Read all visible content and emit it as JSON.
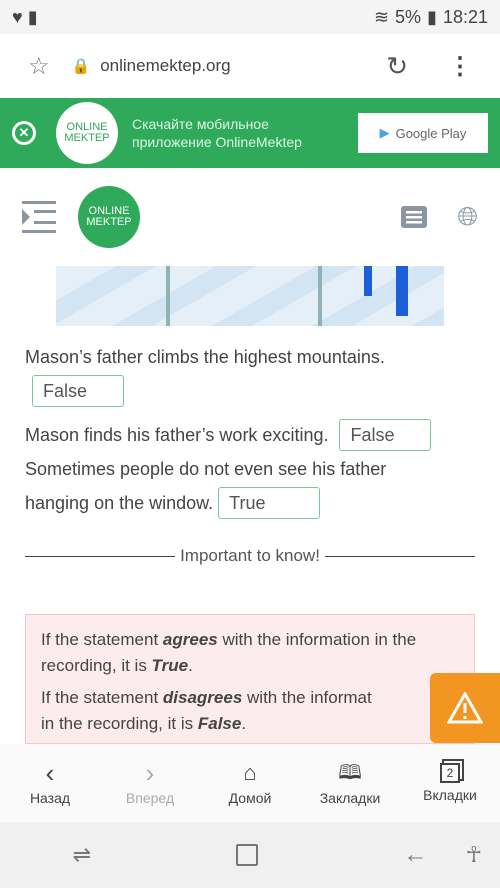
{
  "status": {
    "battery": "5%",
    "time": "18:21"
  },
  "browser": {
    "url": "onlinemektep.org"
  },
  "banner": {
    "logo": "ONLINE MEKTEP",
    "line1": "Скачайте мобильное",
    "line2": "приложение OnlineMektep",
    "store": "Google Play"
  },
  "header": {
    "logo": "ONLINE MEKTEP"
  },
  "statements": [
    {
      "text": "Mason’s father climbs the highest mountains.",
      "answer": "False"
    },
    {
      "text": "Mason finds his father’s work exciting.",
      "answer": "False"
    },
    {
      "text1": "Sometimes people do not even see his father",
      "text2": "hanging on the window.",
      "answer": "True"
    }
  ],
  "important": "Important to know!",
  "note": {
    "p1a": "If the statement ",
    "p1b": "agrees",
    "p1c": " with the information in the recording, it is ",
    "p1d": "True",
    "p2a": "If the statement ",
    "p2b": "disagrees",
    "p2c": " with the informat",
    "p2d": "in the recording, it is ",
    "p2e": "False"
  },
  "nav": {
    "back": "Назад",
    "forward": "Вперед",
    "home": "Домой",
    "bookmarks": "Закладки",
    "tabs": "Вкладки",
    "tab_count": "2"
  },
  "colors": {
    "green": "#2eaa5a",
    "warning": "#f39521"
  }
}
